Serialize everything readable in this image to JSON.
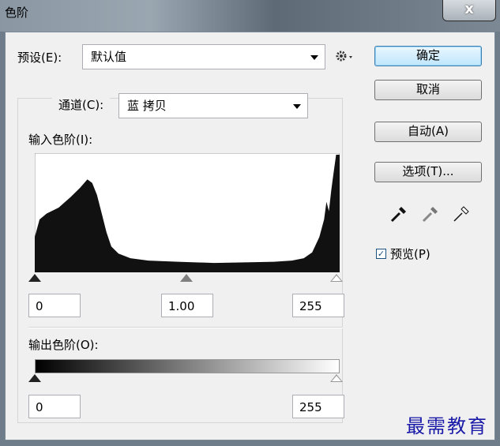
{
  "window": {
    "title": "色阶",
    "close_label": "x"
  },
  "preset": {
    "label": "预设(E):",
    "value": "默认值"
  },
  "channel": {
    "label": "通道(C):",
    "value": "蓝 拷贝"
  },
  "input_levels": {
    "label": "输入色阶(I):",
    "shadow": "0",
    "gamma": "1.00",
    "highlight": "255"
  },
  "output_levels": {
    "label": "输出色阶(O):",
    "low": "0",
    "high": "255"
  },
  "buttons": {
    "ok": "确定",
    "cancel": "取消",
    "auto": "自动(A)",
    "options": "选项(T)..."
  },
  "preview": {
    "label": "预览(P)",
    "checked": true,
    "check_mark": "✓"
  },
  "icons": {
    "preset_menu": "gear-icon",
    "eyedroppers": [
      "black-eyedropper-icon",
      "gray-eyedropper-icon",
      "white-eyedropper-icon"
    ]
  },
  "watermark": "最需教育",
  "chart_data": {
    "type": "area",
    "x_range": [
      0,
      255
    ],
    "profile": [
      [
        0,
        0.3
      ],
      [
        4,
        0.45
      ],
      [
        10,
        0.5
      ],
      [
        20,
        0.55
      ],
      [
        30,
        0.64
      ],
      [
        38,
        0.72
      ],
      [
        44,
        0.79
      ],
      [
        48,
        0.76
      ],
      [
        52,
        0.66
      ],
      [
        56,
        0.5
      ],
      [
        60,
        0.34
      ],
      [
        64,
        0.22
      ],
      [
        70,
        0.16
      ],
      [
        80,
        0.12
      ],
      [
        95,
        0.1
      ],
      [
        120,
        0.09
      ],
      [
        150,
        0.08
      ],
      [
        180,
        0.085
      ],
      [
        200,
        0.09
      ],
      [
        215,
        0.1
      ],
      [
        225,
        0.12
      ],
      [
        232,
        0.17
      ],
      [
        238,
        0.3
      ],
      [
        242,
        0.45
      ],
      [
        244,
        0.6
      ],
      [
        246,
        0.52
      ],
      [
        248,
        0.7
      ],
      [
        250,
        0.85
      ],
      [
        252,
        1.0
      ],
      [
        255,
        1.0
      ]
    ],
    "colors": {
      "fill": "#111111",
      "background": "#ffffff"
    }
  }
}
